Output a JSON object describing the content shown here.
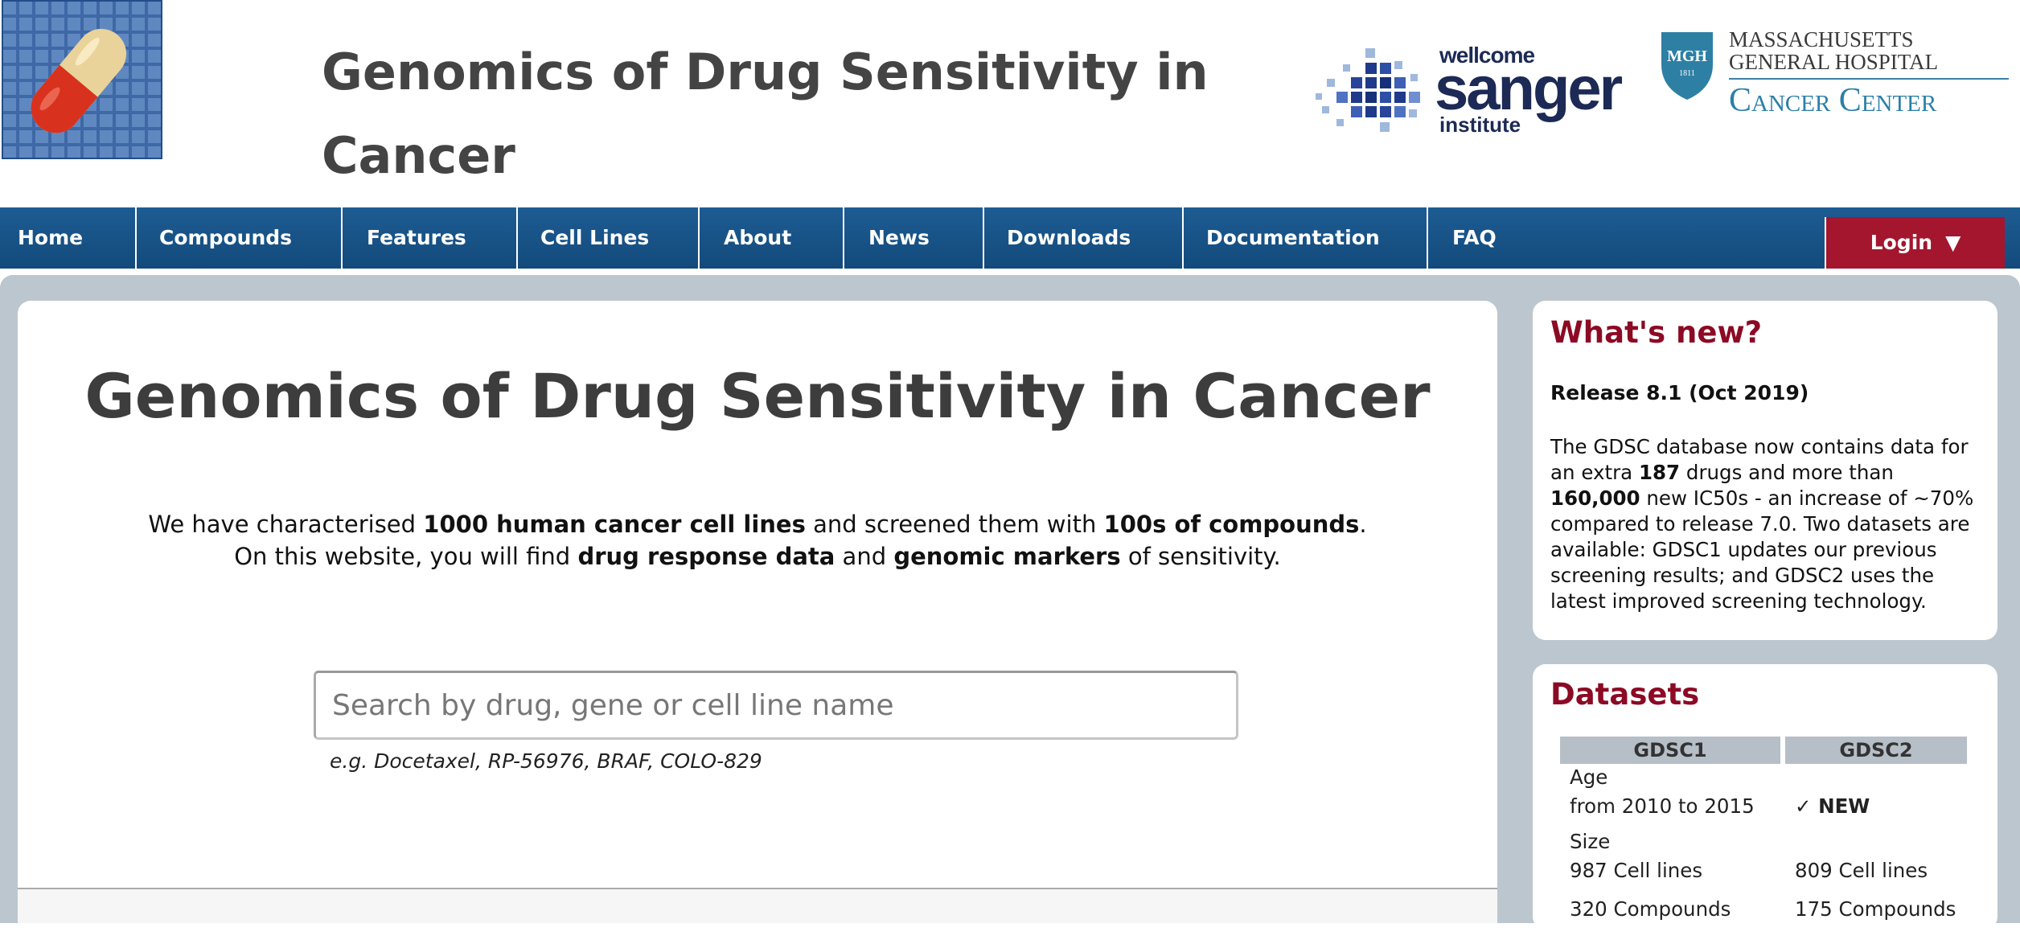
{
  "header": {
    "site_title": "Genomics of Drug Sensitivity in Cancer",
    "partner_logos": {
      "sanger_top": "wellcome",
      "sanger_main": "sanger",
      "sanger_bottom": "institute",
      "mgh_badge": "MGH",
      "mgh_badge_year": "1811",
      "mgh_line1": "MASSACHUSETTS",
      "mgh_line2": "GENERAL HOSPITAL",
      "mgh_line3": "Cancer Center"
    }
  },
  "nav": {
    "items": [
      "Home",
      "Compounds",
      "Features",
      "Cell Lines",
      "About",
      "News",
      "Downloads",
      "Documentation",
      "FAQ"
    ],
    "login_label": "Login",
    "login_arrow": "▼"
  },
  "main": {
    "title": "Genomics of Drug Sensitivity in Cancer",
    "intro_line1": {
      "t1": "We have characterised ",
      "b1": "1000 human cancer cell lines",
      "t2": " and screened them with ",
      "b2": "100s of compounds",
      "t3": "."
    },
    "intro_line2": {
      "t1": "On this website, you will find ",
      "b1": "drug response data",
      "t2": " and ",
      "b2": "genomic markers",
      "t3": " of sensitivity."
    },
    "search": {
      "placeholder": "Search by drug, gene or cell line name",
      "value": "",
      "example": "e.g. Docetaxel, RP-56976, BRAF, COLO-829"
    }
  },
  "sidebar": {
    "news": {
      "heading": "What's new?",
      "release": "Release 8.1 (Oct 2019)",
      "body": {
        "t1": "The GDSC database now contains data for an extra ",
        "b1": "187",
        "t2": " drugs and more than ",
        "b2": "160,000",
        "t3": " new IC50s - an increase of ~70% compared to release 7.0. Two datasets are available: GDSC1 updates our previous screening results; and GDSC2 uses the latest improved screening technology."
      }
    },
    "datasets": {
      "heading": "Datasets",
      "columns": [
        "GDSC1",
        "GDSC2"
      ],
      "age_label": "Age",
      "gdsc1_age": "from 2010 to 2015",
      "gdsc2_age_check": "✓",
      "gdsc2_age": "NEW",
      "size_label": "Size",
      "gdsc1_cells": "987 Cell lines",
      "gdsc2_cells": "809 Cell lines",
      "gdsc1_compounds": "320 Compounds",
      "gdsc2_compounds": "175 Compounds"
    }
  },
  "colors": {
    "nav_bg": "#1a5585",
    "login_bg": "#a3162e",
    "heading_red": "#8c0a24",
    "content_bg": "#bcc6ce"
  }
}
